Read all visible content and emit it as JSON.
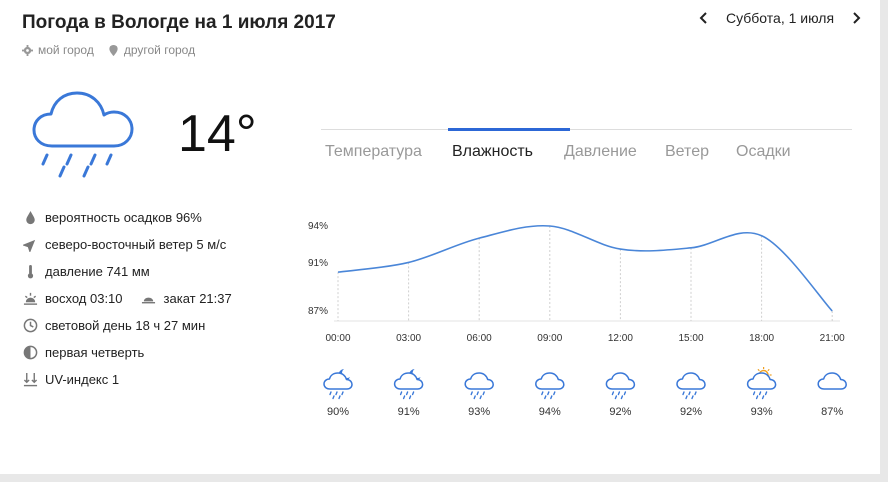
{
  "header": {
    "title": "Погода в Вологде на 1 июля 2017",
    "my_city": "мой город",
    "other_city": "другой город",
    "date": "Суббота, 1 июля"
  },
  "current": {
    "icon": "cloud-rain-icon",
    "temperature": "14°"
  },
  "details": {
    "precip": "вероятность осадков 96%",
    "wind": "северо-восточный ветер 5 м/с",
    "pressure": "давление 741 мм",
    "sunrise": "восход 03:10",
    "sunset": "закат 21:37",
    "daylength": "световой день 18 ч 27 мин",
    "moon": "первая четверть",
    "uv": "UV-индекс 1"
  },
  "tabs": [
    {
      "label": "Температура",
      "active": false
    },
    {
      "label": "Влажность",
      "active": true
    },
    {
      "label": "Давление",
      "active": false
    },
    {
      "label": "Ветер",
      "active": false
    },
    {
      "label": "Осадки",
      "active": false
    }
  ],
  "colors": {
    "accent": "#2c67d6",
    "line": "#4a86d8",
    "icon": "#3a78d8",
    "sun": "#f0a020"
  },
  "chart_data": {
    "type": "line",
    "x": [
      "00:00",
      "03:00",
      "06:00",
      "09:00",
      "12:00",
      "15:00",
      "18:00",
      "21:00"
    ],
    "y_ticks": [
      "94%",
      "91%",
      "87%"
    ],
    "ylim": [
      87,
      94
    ],
    "series": [
      {
        "values": [
          90.2,
          91,
          93,
          94,
          92.1,
          92.2,
          93.2,
          87
        ]
      }
    ],
    "hourly_icons": [
      "cloud-rain-moon-icon",
      "cloud-rain-moon-icon",
      "cloud-rain-icon",
      "cloud-rain-icon",
      "cloud-rain-icon",
      "cloud-rain-icon",
      "cloud-rain-sun-icon",
      "cloud-icon"
    ],
    "hourly_labels": [
      "90%",
      "91%",
      "93%",
      "94%",
      "92%",
      "92%",
      "93%",
      "87%"
    ]
  }
}
